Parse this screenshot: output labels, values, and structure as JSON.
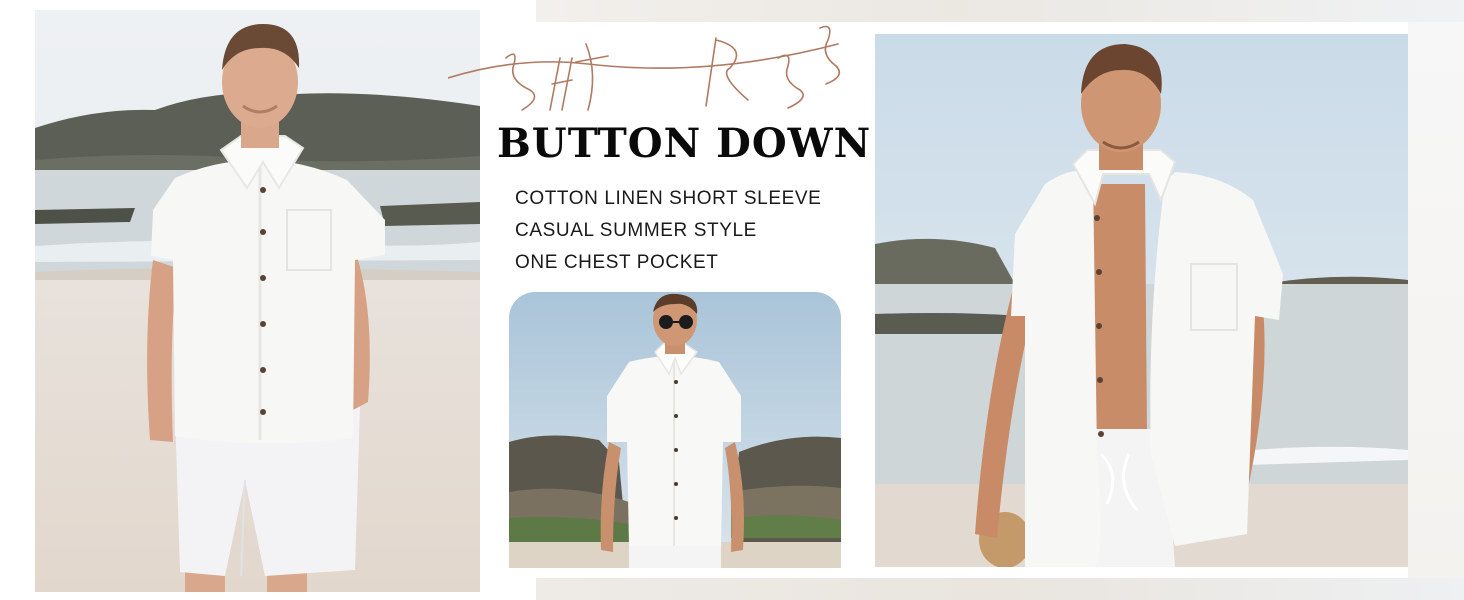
{
  "banner": {
    "script_title": "SHIRTS",
    "headline": "BUTTON DOWN",
    "features": [
      "COTTON LINEN SHORT SLEEVE",
      "CASUAL SUMMER STYLE",
      "ONE CHEST POCKET"
    ]
  },
  "colors": {
    "script_title": "#b07a62",
    "headline": "#0a0a0a",
    "shirt": "#f6f6f4",
    "sky": "#dfe9f0",
    "sand": "#ece7e1",
    "rocks": "#5d6152"
  }
}
